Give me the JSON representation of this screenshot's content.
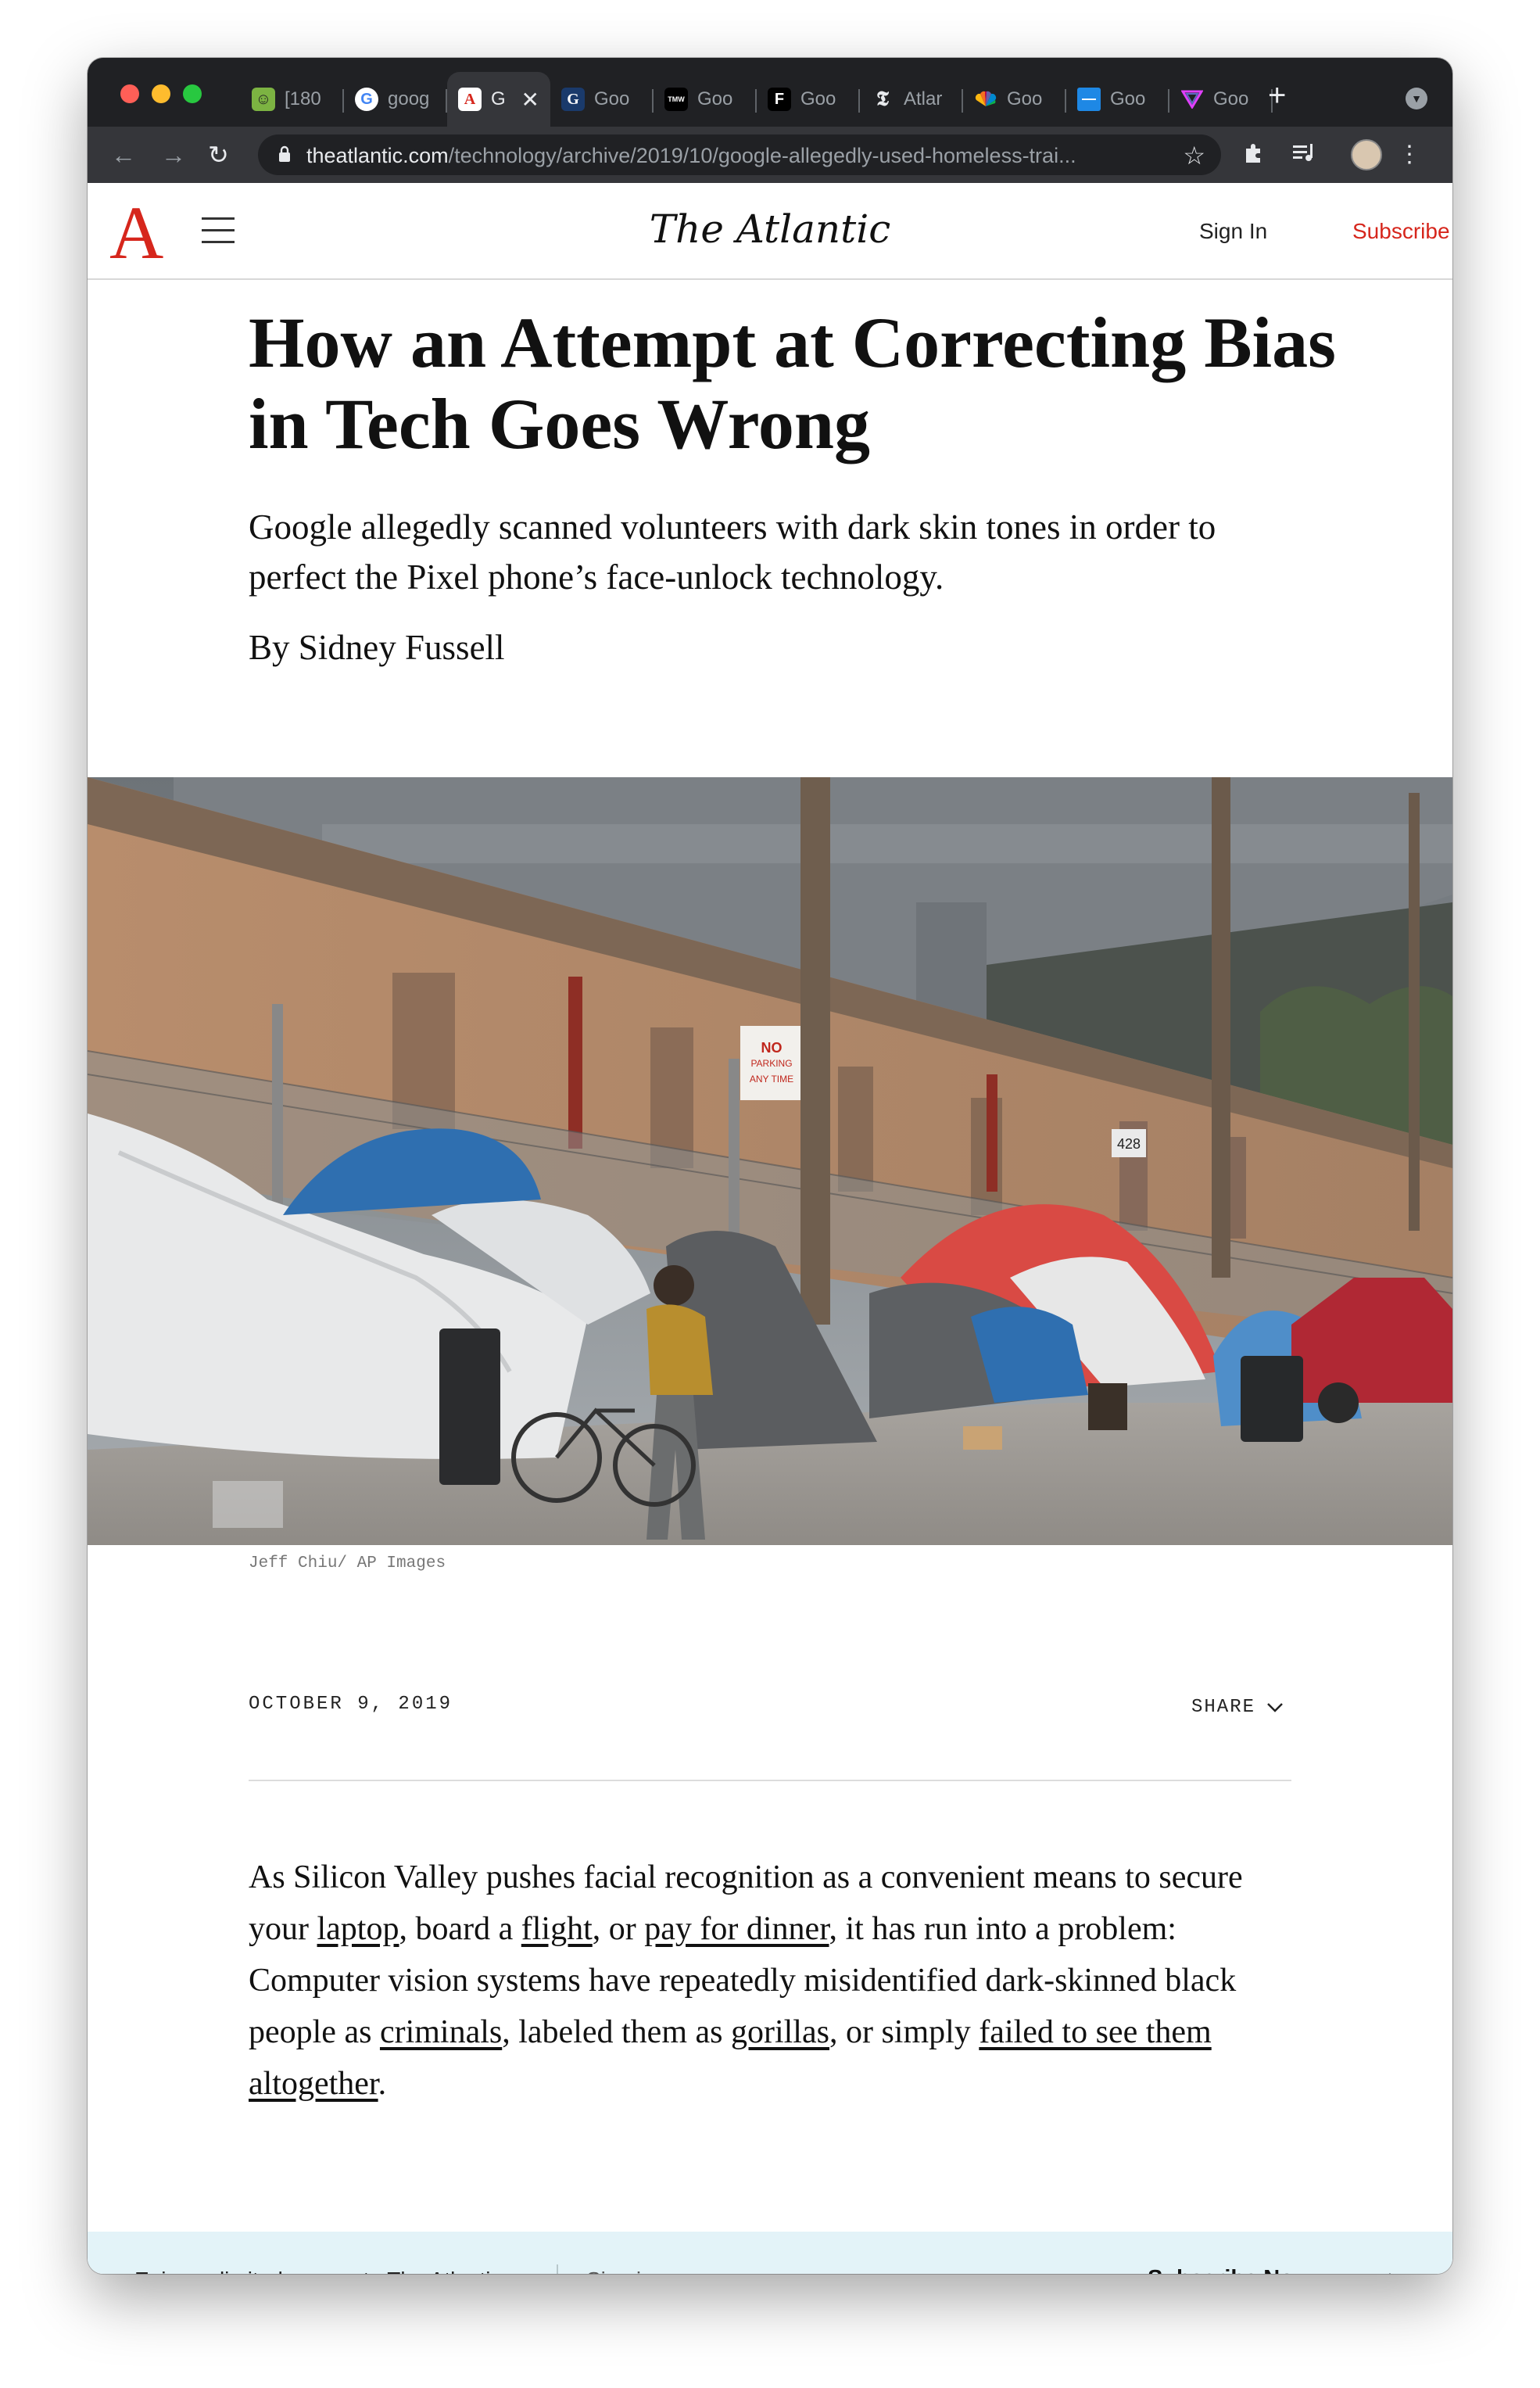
{
  "browser": {
    "tabs": [
      {
        "label": "[180",
        "favicon": "emoji-icon",
        "color": "#7cb342"
      },
      {
        "label": "goog",
        "favicon": "google-icon",
        "color": "#ffffff"
      },
      {
        "label": "G",
        "favicon": "atlantic-icon",
        "color": "#ffffff",
        "active": true
      },
      {
        "label": "Goo",
        "favicon": "g-icon",
        "color": "#1a3a6b"
      },
      {
        "label": "Goo",
        "favicon": "tmw-icon",
        "color": "#000000"
      },
      {
        "label": "Goo",
        "favicon": "f-icon",
        "color": "#000000"
      },
      {
        "label": "Atlar",
        "favicon": "nyt-icon",
        "color": "#000000"
      },
      {
        "label": "Goo",
        "favicon": "nbc-icon",
        "color": "#ffffff"
      },
      {
        "label": "Goo",
        "favicon": "blue-square-icon",
        "color": "#1e88e5"
      },
      {
        "label": "Goo",
        "favicon": "verge-icon",
        "color": "#e040fb"
      }
    ],
    "close_glyph": "✕",
    "new_tab_glyph": "+",
    "url_host": "theatlantic.com",
    "url_path": "/technology/archive/2019/10/google-allegedly-used-homeless-trai..."
  },
  "site": {
    "logo": "A",
    "title": "The Atlantic",
    "signin": "Sign In",
    "subscribe": "Subscribe",
    "accent": "#d6261c"
  },
  "article": {
    "headline": "How an Attempt at Correcting Bias in Tech Goes Wrong",
    "dek": "Google allegedly scanned volunteers with dark skin tones in order to perfect the Pixel phone’s face-unlock technology.",
    "byline": "By Sidney Fussell",
    "photo_caption": "Jeff Chiu/ AP Images",
    "photo_sign_no": "NO",
    "photo_sign_parking": "PARKING",
    "photo_sign_anytime": "ANY TIME",
    "photo_number": "428",
    "date": "OCTOBER 9, 2019",
    "share": "SHARE",
    "body": {
      "t1": "As Silicon Valley pushes facial recognition as a convenient means to secure your ",
      "l1": "laptop",
      "t2": ", board a ",
      "l2": "flight",
      "t3": ", or ",
      "l3": "pay for dinner",
      "t4": ", it has run into a problem: Computer vision systems have repeatedly misidentified dark-skinned black people as ",
      "l4": "criminals",
      "t5": ", labeled them as ",
      "l5": "gorillas",
      "t6": ", or simply ",
      "l6": "failed to see them altogether",
      "t7": "."
    }
  },
  "banner": {
    "text": "Enjoy unlimited access to The Atlantic.",
    "signin": "Sign in",
    "subscribe": "Subscribe Now",
    "accent": "#1565c0"
  }
}
